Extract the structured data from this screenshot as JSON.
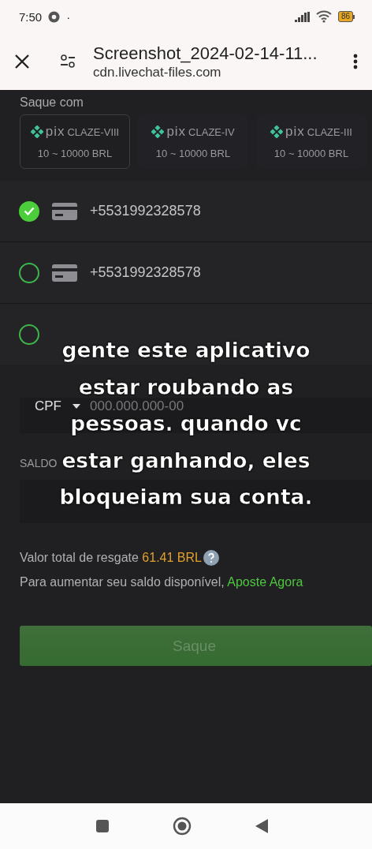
{
  "status_bar": {
    "time": "7:50",
    "dot": "·",
    "battery": "86"
  },
  "toolbar": {
    "title": "Screenshot_2024-02-14-11...",
    "subtitle": "cdn.livechat-files.com"
  },
  "withdraw": {
    "section_label": "Saque com",
    "methods": [
      {
        "brand": "pix",
        "name": "CLAZE-VIII",
        "range": "10 ~ 10000 BRL",
        "selected": true
      },
      {
        "brand": "pix",
        "name": "CLAZE-IV",
        "range": "10 ~ 10000 BRL",
        "selected": false
      },
      {
        "brand": "pix",
        "name": "CLAZE-III",
        "range": "10 ~ 10000 BRL",
        "selected": false
      }
    ],
    "accounts": [
      {
        "kind": "phone",
        "number": "+5531992328578",
        "selected": true
      },
      {
        "kind": "phone",
        "number": "+5531992328578",
        "selected": false
      },
      {
        "kind": "new",
        "selected": false
      }
    ],
    "id_field": {
      "type": "CPF",
      "placeholder": "000.000.000-00"
    },
    "balance_label": "SALDO",
    "total": {
      "label": "Valor total de resgate",
      "amount": "61.41 BRL"
    },
    "hint": {
      "text": "Para aumentar seu saldo disponível,",
      "link": "Aposte Agora"
    },
    "submit": "Saque"
  },
  "caption_lines": [
    "gente este aplicativo",
    "estar roubando as",
    "pessoas. quando vc",
    "estar ganhando, eles",
    "bloqueiam sua conta."
  ]
}
